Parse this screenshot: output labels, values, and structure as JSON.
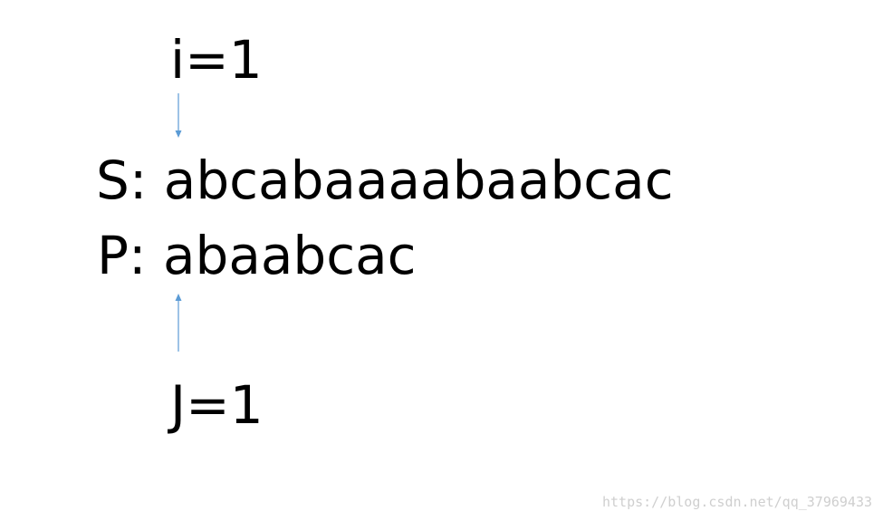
{
  "pointer_i": {
    "label": "i=1"
  },
  "text_s": {
    "prefix": "S:",
    "value": "abcabaaaabaabcac"
  },
  "pattern_p": {
    "prefix": "P:",
    "value": "abaabcac"
  },
  "pointer_j": {
    "label": "J=1"
  },
  "arrow_color": "#5b9bd5",
  "watermark": "https://blog.csdn.net/qq_37969433"
}
